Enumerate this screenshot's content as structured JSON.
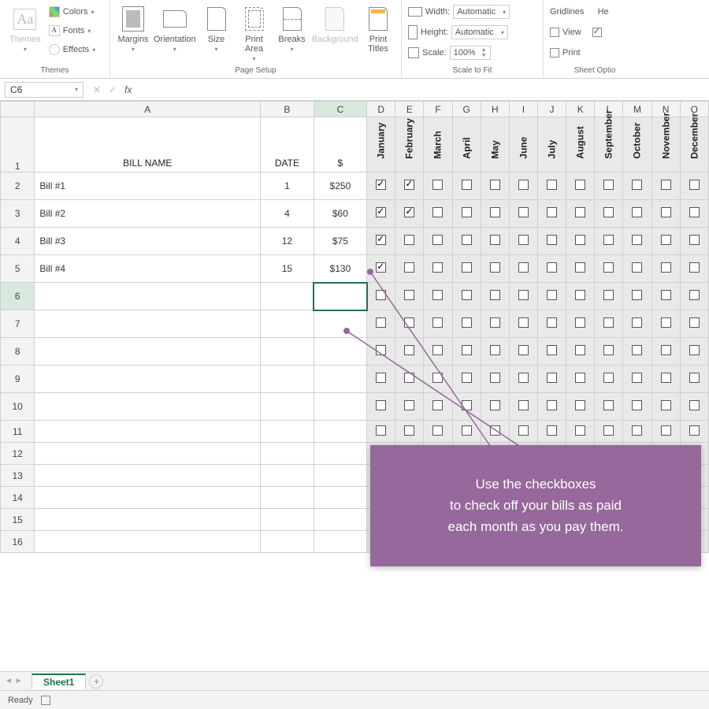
{
  "ribbon": {
    "themes": {
      "label": "Themes",
      "themes_btn": "Themes",
      "colors": "Colors",
      "fonts": "Fonts",
      "effects": "Effects"
    },
    "page_setup": {
      "label": "Page Setup",
      "margins": "Margins",
      "orientation": "Orientation",
      "size": "Size",
      "print_area": "Print\nArea",
      "breaks": "Breaks",
      "background": "Background",
      "print_titles": "Print\nTitles"
    },
    "scale": {
      "label": "Scale to Fit",
      "width_lbl": "Width:",
      "height_lbl": "Height:",
      "scale_lbl": "Scale:",
      "width_val": "Automatic",
      "height_val": "Automatic",
      "scale_val": "100%"
    },
    "sheet_options": {
      "label": "Sheet Optio",
      "gridlines": "Gridlines",
      "headings": "He",
      "view": "View",
      "print": "Print"
    }
  },
  "namebox": {
    "value": "C6"
  },
  "columns": [
    "A",
    "B",
    "C",
    "D",
    "E",
    "F",
    "G",
    "H",
    "I",
    "J",
    "K",
    "L",
    "M",
    "N",
    "O"
  ],
  "header": {
    "bill_name": "BILL NAME",
    "date": "DATE",
    "dollar": "$",
    "months": [
      "January",
      "February",
      "March",
      "April",
      "May",
      "June",
      "July",
      "August",
      "September",
      "October",
      "November",
      "December"
    ]
  },
  "rows": [
    {
      "r": 2,
      "name": "Bill #1",
      "date": "1",
      "amt": "$250",
      "checked": [
        true,
        true,
        false,
        false,
        false,
        false,
        false,
        false,
        false,
        false,
        false,
        false
      ]
    },
    {
      "r": 3,
      "name": "Bill #2",
      "date": "4",
      "amt": "$60",
      "checked": [
        true,
        true,
        false,
        false,
        false,
        false,
        false,
        false,
        false,
        false,
        false,
        false
      ]
    },
    {
      "r": 4,
      "name": "Bill #3",
      "date": "12",
      "amt": "$75",
      "checked": [
        true,
        false,
        false,
        false,
        false,
        false,
        false,
        false,
        false,
        false,
        false,
        false
      ]
    },
    {
      "r": 5,
      "name": "Bill #4",
      "date": "15",
      "amt": "$130",
      "checked": [
        true,
        false,
        false,
        false,
        false,
        false,
        false,
        false,
        false,
        false,
        false,
        false
      ]
    }
  ],
  "empty_rows": [
    6,
    7,
    8,
    9,
    10,
    11,
    12,
    13,
    14,
    15,
    16
  ],
  "selected_cell": "C6",
  "tabs": {
    "sheet1": "Sheet1"
  },
  "status": {
    "ready": "Ready"
  },
  "callout": {
    "line1": "Use the checkboxes",
    "line2": "to check off your bills as paid",
    "line3": "each month as you pay them."
  }
}
